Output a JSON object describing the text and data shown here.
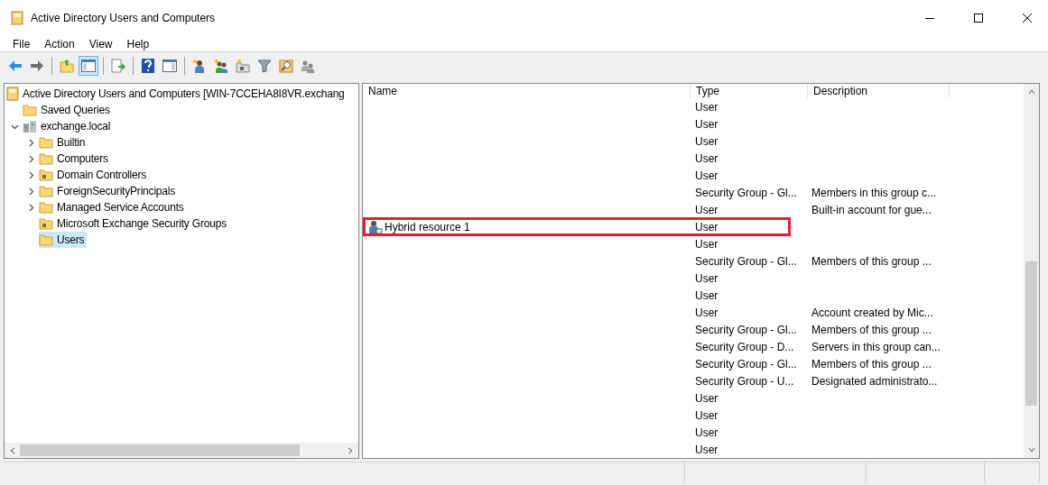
{
  "window": {
    "title": "Active Directory Users and Computers"
  },
  "menu": [
    "File",
    "Action",
    "View",
    "Help"
  ],
  "toolbar": [
    {
      "kind": "back",
      "selected": false
    },
    {
      "kind": "forward",
      "selected": false
    },
    {
      "kind": "sep"
    },
    {
      "kind": "up",
      "selected": false
    },
    {
      "kind": "tree",
      "selected": true
    },
    {
      "kind": "sep"
    },
    {
      "kind": "export",
      "selected": false
    },
    {
      "kind": "sep"
    },
    {
      "kind": "help",
      "selected": false
    },
    {
      "kind": "panel",
      "selected": false
    },
    {
      "kind": "sep"
    },
    {
      "kind": "user",
      "selected": false
    },
    {
      "kind": "group",
      "selected": false
    },
    {
      "kind": "ou",
      "selected": false
    },
    {
      "kind": "filter",
      "selected": false
    },
    {
      "kind": "find",
      "selected": false
    },
    {
      "kind": "users",
      "selected": false
    }
  ],
  "tree": [
    {
      "label": "Active Directory Users and Computers [WIN-7CCEHA8I8VR.exchang",
      "kind": "console",
      "selected": false,
      "children": [
        {
          "label": "Saved Queries",
          "kind": "folder",
          "selected": false
        },
        {
          "label": "exchange.local",
          "kind": "domain",
          "expanded": true,
          "selected": false,
          "children": [
            {
              "label": "Builtin",
              "kind": "folder",
              "expanded": false,
              "selected": false
            },
            {
              "label": "Computers",
              "kind": "folder",
              "expanded": false,
              "selected": false
            },
            {
              "label": "Domain Controllers",
              "kind": "ou",
              "expanded": false,
              "selected": false
            },
            {
              "label": "ForeignSecurityPrincipals",
              "kind": "folder",
              "expanded": false,
              "selected": false
            },
            {
              "label": "Managed Service Accounts",
              "kind": "folder",
              "expanded": false,
              "selected": false
            },
            {
              "label": "Microsoft Exchange Security Groups",
              "kind": "ou",
              "selected": false
            },
            {
              "label": "Users",
              "kind": "folder",
              "selected": true
            }
          ]
        }
      ]
    }
  ],
  "table": {
    "columns": [
      "Name",
      "Type",
      "Description"
    ],
    "rows": [
      {
        "type": "User",
        "highlighted": false
      },
      {
        "type": "User",
        "highlighted": false
      },
      {
        "type": "User",
        "highlighted": false
      },
      {
        "type": "User",
        "highlighted": false
      },
      {
        "type": "User",
        "highlighted": false
      },
      {
        "type": "Security Group - Gl...",
        "description": "Members in this group c...",
        "highlighted": false
      },
      {
        "type": "User",
        "description": "Built-in account for gue...",
        "highlighted": false
      },
      {
        "name": "Hybrid resource 1",
        "type": "User",
        "highlighted": true
      },
      {
        "type": "User",
        "highlighted": false
      },
      {
        "type": "Security Group - Gl...",
        "description": "Members of this group ...",
        "highlighted": false
      },
      {
        "type": "User",
        "highlighted": false
      },
      {
        "type": "User",
        "highlighted": false
      },
      {
        "type": "User",
        "description": "Account created by Mic...",
        "highlighted": false
      },
      {
        "type": "Security Group - Gl...",
        "description": "Members of this group ...",
        "highlighted": false
      },
      {
        "type": "Security Group - D...",
        "description": "Servers in this group can...",
        "highlighted": false
      },
      {
        "type": "Security Group - Gl...",
        "description": "Members of this group ...",
        "highlighted": false
      },
      {
        "type": "Security Group - U...",
        "description": "Designated administrato...",
        "highlighted": false
      },
      {
        "type": "User",
        "highlighted": false
      },
      {
        "type": "User",
        "highlighted": false
      },
      {
        "type": "User",
        "highlighted": false
      },
      {
        "type": "User",
        "highlighted": false
      }
    ]
  }
}
